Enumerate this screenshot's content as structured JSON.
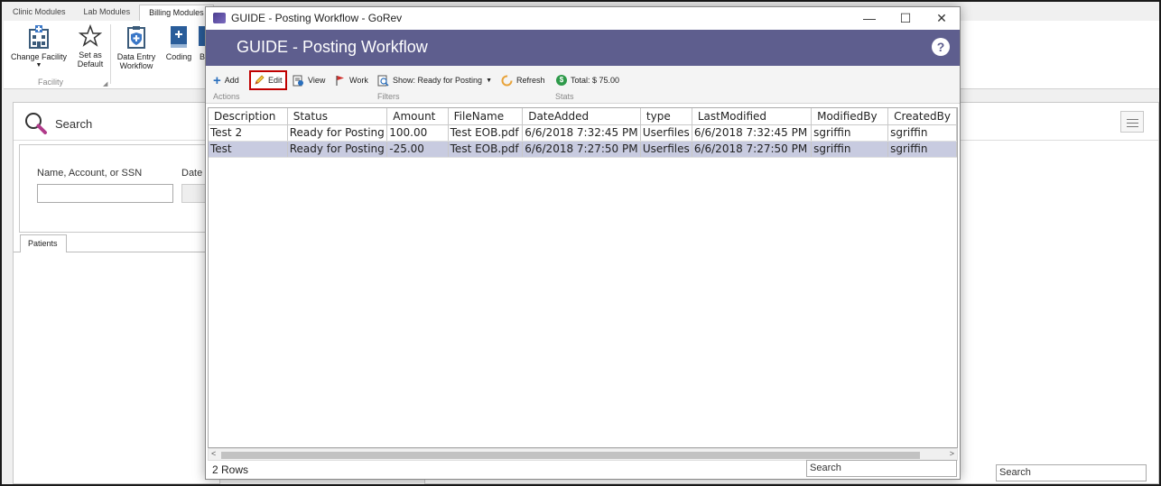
{
  "background": {
    "tabs": [
      "Clinic Modules",
      "Lab Modules",
      "Billing Modules"
    ],
    "ribbon": {
      "change_facility": "Change Facility",
      "set_as_default": "Set as\nDefault",
      "data_entry_workflow": "Data Entry\nWorkflow",
      "coding": "Coding",
      "partial_b": "B",
      "group_label": "Facility"
    },
    "search_title": "Search",
    "name_account_ssn_label": "Name, Account, or SSN",
    "date_label_partial": "Date o",
    "patients_tab": "Patients",
    "search_placeholder": "Search"
  },
  "dialog": {
    "window_title": "GUIDE - Posting Workflow - GoRev",
    "header_title": "GUIDE - Posting Workflow",
    "toolbar": {
      "add": "Add",
      "edit": "Edit",
      "view": "View",
      "work": "Work",
      "show": "Show: Ready for Posting",
      "refresh": "Refresh",
      "total": "Total: $ 75.00"
    },
    "groups": {
      "actions": "Actions",
      "filters": "Filters",
      "stats": "Stats"
    },
    "columns": [
      "Description",
      "Status",
      "Amount",
      "FileName",
      "DateAdded",
      "type",
      "LastModified",
      "ModifiedBy",
      "CreatedBy"
    ],
    "rows": [
      [
        "Test 2",
        "Ready for Posting",
        "100.00",
        "Test EOB.pdf",
        "6/6/2018 7:32:45 PM",
        "Userfiles",
        "6/6/2018 7:32:45 PM",
        "sgriffin",
        "sgriffin"
      ],
      [
        "Test",
        "Ready for Posting",
        "-25.00",
        "Test EOB.pdf",
        "6/6/2018 7:27:50 PM",
        "Userfiles",
        "6/6/2018 7:27:50 PM",
        "sgriffin",
        "sgriffin"
      ]
    ],
    "selected_row": 1,
    "rows_count": "2 Rows",
    "search_placeholder": "Search"
  },
  "colors": {
    "header": "#5e5e8e",
    "highlight_box": "#c00000",
    "selected_row": "#c8cbe0"
  }
}
